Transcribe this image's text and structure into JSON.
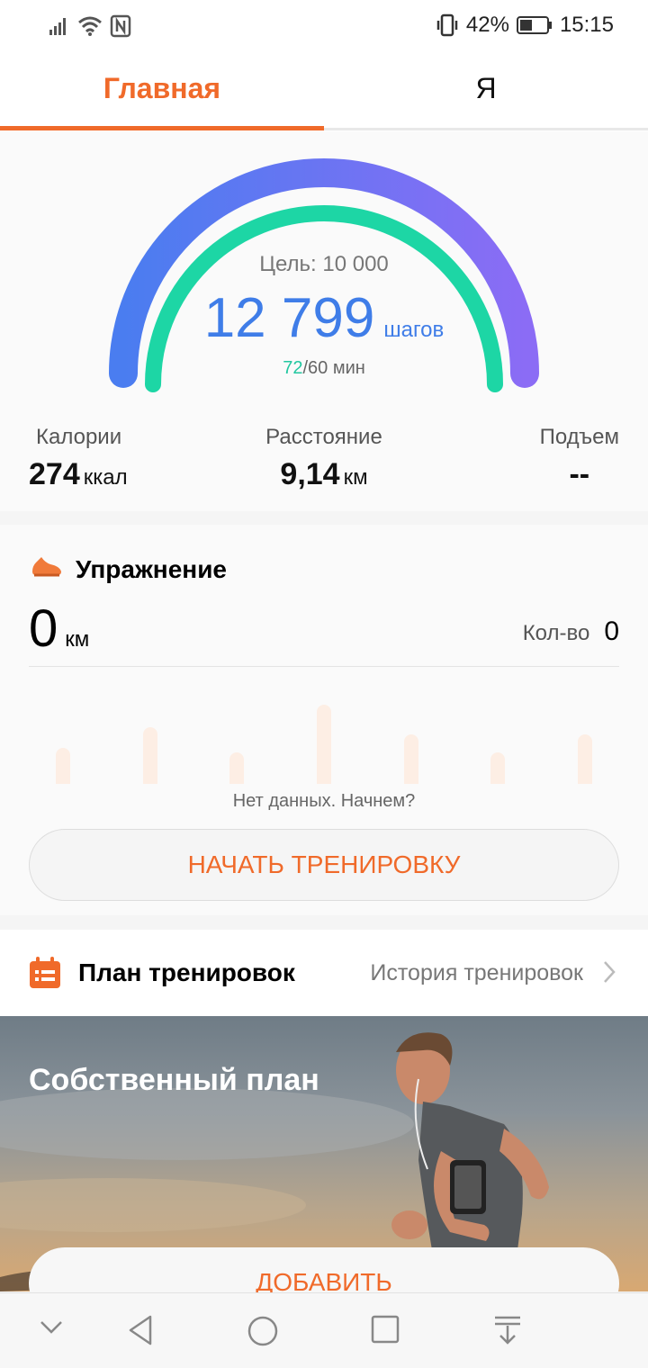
{
  "status_bar": {
    "battery": "42%",
    "time": "15:15",
    "icons": [
      "signal-icon",
      "wifi-icon",
      "nfc-icon",
      "vibrate-icon",
      "battery-icon"
    ]
  },
  "tabs": [
    {
      "label": "Главная",
      "active": true
    },
    {
      "label": "Я",
      "active": false
    }
  ],
  "steps": {
    "goal": "Цель: 10 000",
    "value": "12 799",
    "unit": "шагов",
    "active_minutes": "72",
    "minutes_suffix": "/60 мин"
  },
  "stats": [
    {
      "label": "Калории",
      "value": "274",
      "unit": "ккал"
    },
    {
      "label": "Расстояние",
      "value": "9,14",
      "unit": "км"
    },
    {
      "label": "Подъем",
      "value": "--",
      "unit": ""
    }
  ],
  "exercise": {
    "title": "Упражнение",
    "distance_value": "0",
    "distance_unit": "км",
    "count_label": "Кол-во",
    "count_value": "0",
    "bars": [
      0.45,
      0.72,
      0.4,
      1.0,
      0.63,
      0.4,
      0.63
    ],
    "no_data": "Нет данных. Начнем?",
    "start_button": "НАЧАТЬ ТРЕНИРОВКУ"
  },
  "plan": {
    "title": "План тренировок",
    "history_link": "История тренировок"
  },
  "banner": {
    "title": "Собственный план",
    "add_button": "ДОБАВИТЬ"
  },
  "colors": {
    "accent": "#f06a2a",
    "steps_blue": "#3f7de8",
    "active_green": "#21c7a0"
  }
}
